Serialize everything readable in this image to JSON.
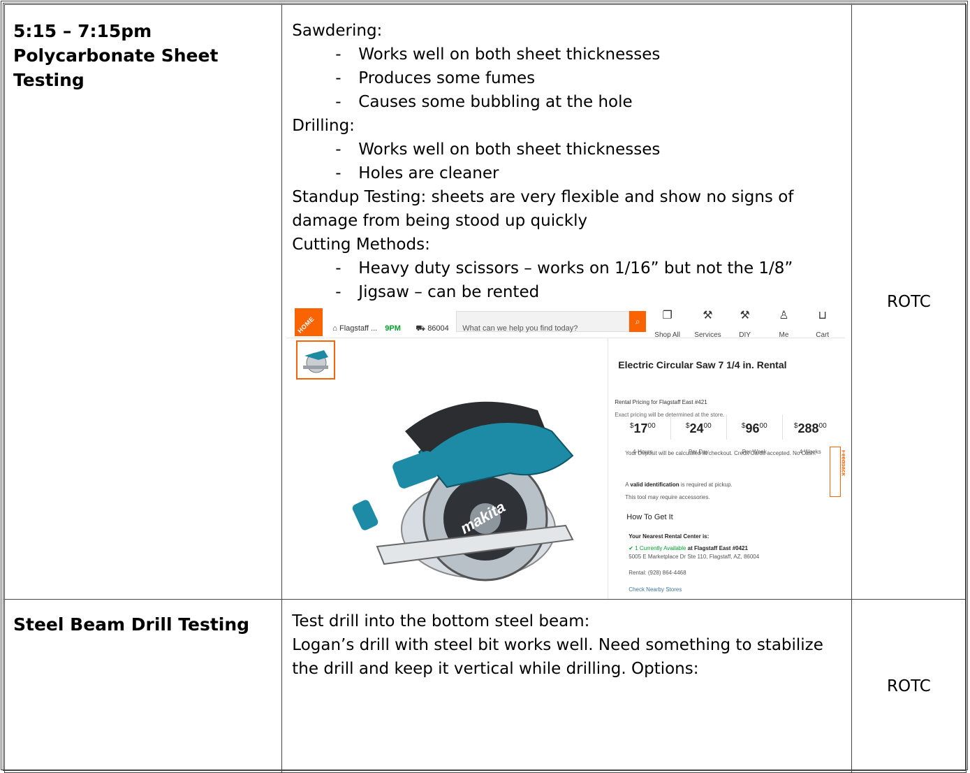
{
  "rows": [
    {
      "title_lines": [
        "5:15 – 7:15pm",
        "Polycarbonate Sheet",
        "Testing"
      ],
      "org": "ROTC",
      "notes": {
        "sawdering_heading": "Sawdering:",
        "sawdering_items": [
          "Works well on both sheet thicknesses",
          "Produces some fumes",
          "Causes some bubbling at the hole"
        ],
        "drilling_heading": "Drilling:",
        "drilling_items": [
          "Works well on both sheet thicknesses",
          "Holes are cleaner"
        ],
        "standup_line1": "Standup Testing: sheets are very flexible and show no signs of",
        "standup_line2": "damage from being stood up quickly",
        "cutting_heading": "Cutting Methods:",
        "cutting_items": [
          "Heavy duty scissors – works on 1/16” but not the 1/8”",
          "Jigsaw – can be rented"
        ]
      }
    },
    {
      "title_lines": [
        "Steel Beam Drill Testing"
      ],
      "org": "ROTC",
      "notes": {
        "line1": "Test drill into the bottom steel beam:",
        "line2": "Logan’s drill with steel bit works well. Need something to stabilize",
        "line3": "the drill and keep it vertical while drilling. Options:"
      }
    }
  ],
  "screenshot": {
    "logo_text": "THE HOME DEPOT",
    "store_label": "Flagstaff ...",
    "store_hours": "9PM",
    "zip": "86004",
    "search_placeholder": "What can we help you find today?",
    "nav": [
      "Shop All",
      "Services",
      "DIY",
      "Me",
      "Cart"
    ],
    "product_title": "Electric Circular Saw 7 1/4 in. Rental",
    "saw_brand": "makita",
    "pricing_title": "Rental Pricing for Flagstaff East #421",
    "pricing_note": "Exact pricing will be determined at the store.",
    "prices": [
      {
        "dollars": "17",
        "cents": "00",
        "period": "4-Hours"
      },
      {
        "dollars": "24",
        "cents": "00",
        "period": "Per Day"
      },
      {
        "dollars": "96",
        "cents": "00",
        "period": "Per Week"
      },
      {
        "dollars": "288",
        "cents": "00",
        "period": "4 Weeks"
      }
    ],
    "deposit_note": "Your Deposit will be calculated at checkout. Credit Cards accepted. No Cash.",
    "valid_prefix": "A ",
    "valid_bold": "valid identification",
    "valid_suffix": " is required at pickup.",
    "accessories_note": "This tool may require accessories.",
    "how_to_get": "How To Get It",
    "nearest_label": "Your Nearest Rental Center is:",
    "availability": "1 Currently Available",
    "availability_store": " at Flagstaff East #0421",
    "address": "5005 E Marketplace Dr Ste 110, Flagstaff, AZ, 86004",
    "rental_phone": "Rental: (928) 864-4468",
    "check_nearby": "Check Nearby Stores",
    "feedback": "Feedback"
  }
}
